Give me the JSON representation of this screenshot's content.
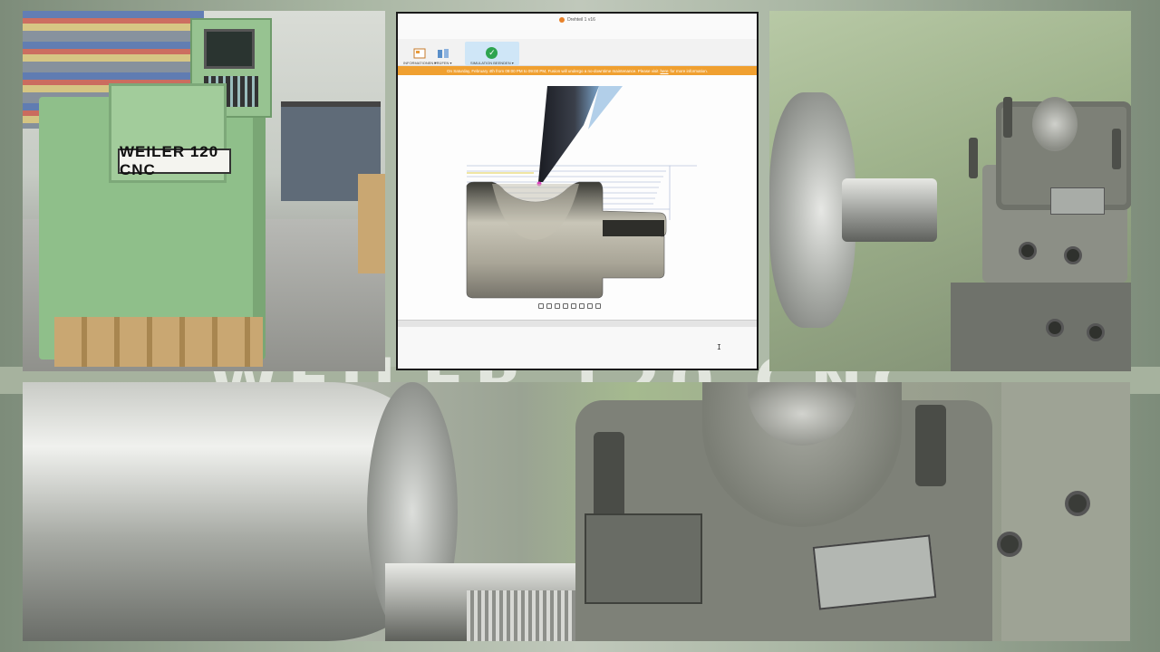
{
  "machine_photo": {
    "brand_plate": "WEILER 120 CNC"
  },
  "cad": {
    "window_title": "Drehteil 1 v16",
    "toolbar": [
      {
        "label": "INFORMATIONEN ▾",
        "icon": "info-panel-icon"
      },
      {
        "label": "PRÜFEN ▾",
        "icon": "inspect-icon"
      },
      {
        "label": "SIMULATION BEENDEN ▾",
        "icon": "checkmark-icon",
        "active": true
      }
    ],
    "banner": {
      "text_before": "On Saturday, February 4th from 09:00 PM to 09:00 PM, Fusion will undergo a no-downtime maintenance. Please visit",
      "link": "here",
      "text_after": "for more information."
    },
    "colors": {
      "banner": "#f0a030",
      "active_tool": "#cfe6f7",
      "check": "#2ea44f"
    }
  },
  "closeup": {
    "watermark": "WEILER 120 CNC"
  }
}
